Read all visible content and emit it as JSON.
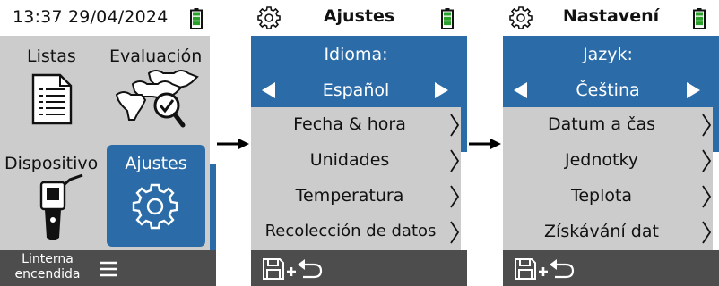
{
  "screen1": {
    "clock": "13:37 29/04/2024",
    "tiles": [
      {
        "label": "Listas"
      },
      {
        "label": "Evaluación"
      },
      {
        "label": "Dispositivo"
      },
      {
        "label": "Ajustes"
      }
    ],
    "footer": {
      "line1": "Linterna",
      "line2": "encendida",
      "menu_icon": "hamburger-icon"
    }
  },
  "screen2": {
    "title": "Ajustes",
    "language": {
      "heading": "Idioma:",
      "value": "Español"
    },
    "items": [
      {
        "label": "Fecha & hora"
      },
      {
        "label": "Unidades"
      },
      {
        "label": "Temperatura"
      },
      {
        "label": "Recolección de datos"
      }
    ],
    "footer": {
      "icon": "save-and-return-icon"
    }
  },
  "screen3": {
    "title": "Nastavení",
    "language": {
      "heading": "Jazyk:",
      "value": "Čeština"
    },
    "items": [
      {
        "label": "Datum a čas"
      },
      {
        "label": "Jednotky"
      },
      {
        "label": "Teplota"
      },
      {
        "label": "Získávání dat"
      }
    ],
    "footer": {
      "icon": "save-and-return-icon"
    }
  },
  "colors": {
    "accent": "#2b6ca8",
    "list_bg": "#cccccc",
    "footer_bg": "#4d4d4d",
    "battery": "#2aa02a"
  }
}
